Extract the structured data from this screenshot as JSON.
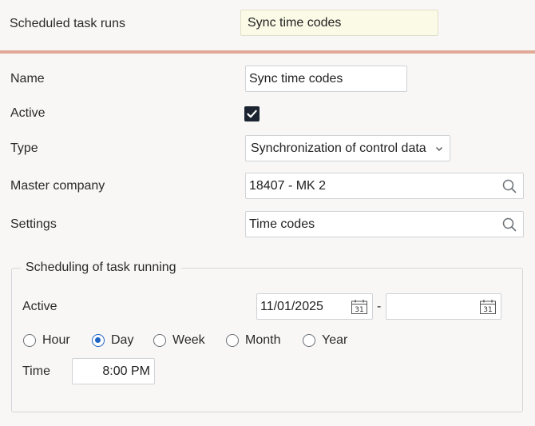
{
  "header": {
    "title": "Scheduled task runs",
    "record_name": "Sync time codes"
  },
  "form": {
    "name_label": "Name",
    "name_value": "Sync time codes",
    "active_label": "Active",
    "active_checked": true,
    "type_label": "Type",
    "type_value": "Synchronization of control data",
    "master_company_label": "Master company",
    "master_company_value": "18407 - MK 2",
    "settings_label": "Settings",
    "settings_value": "Time codes"
  },
  "scheduling": {
    "legend": "Scheduling of task running",
    "active_label": "Active",
    "date_from": "11/01/2025",
    "date_separator": "-",
    "date_to": "",
    "calendar_day_text": "31",
    "frequency_options": [
      "Hour",
      "Day",
      "Week",
      "Month",
      "Year"
    ],
    "frequency_selected": "Day",
    "time_label": "Time",
    "time_value": "8:00 PM"
  },
  "colors": {
    "accent_line": "#e1a996",
    "radio_selected": "#1f63c6",
    "checkbox_fill": "#1b2430",
    "highlight_box": "#fbfae6"
  }
}
